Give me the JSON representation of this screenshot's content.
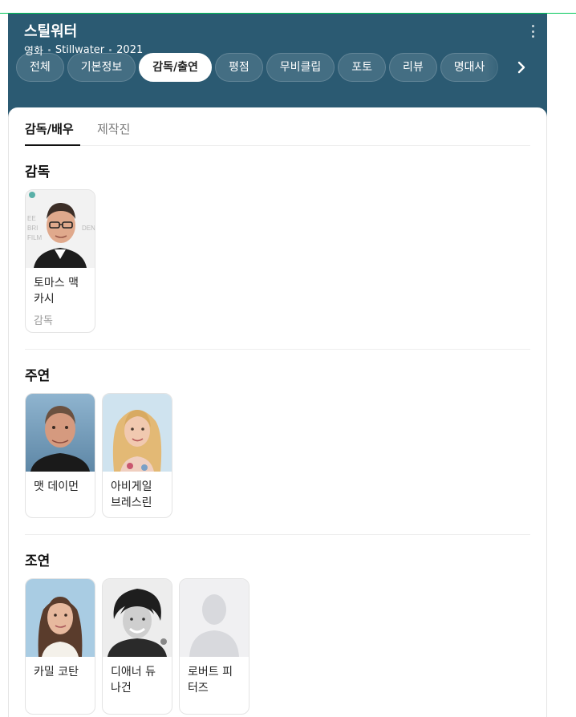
{
  "movie": {
    "title": "스틸워터",
    "type": "영화",
    "original_title": "Stillwater",
    "year": "2021"
  },
  "tabs": [
    {
      "label": "전체",
      "active": false
    },
    {
      "label": "기본정보",
      "active": false
    },
    {
      "label": "감독/출연",
      "active": true
    },
    {
      "label": "평점",
      "active": false
    },
    {
      "label": "무비클립",
      "active": false
    },
    {
      "label": "포토",
      "active": false
    },
    {
      "label": "리뷰",
      "active": false
    },
    {
      "label": "명대사",
      "active": false
    }
  ],
  "subtabs": [
    {
      "label": "감독/배우",
      "active": true
    },
    {
      "label": "제작진",
      "active": false
    }
  ],
  "sections": {
    "director": {
      "title": "감독",
      "people": [
        {
          "name": "토마스 맥카시",
          "role": "감독"
        }
      ]
    },
    "lead": {
      "title": "주연",
      "people": [
        {
          "name": "맷 데이먼"
        },
        {
          "name": "아비게일 브레스린"
        }
      ]
    },
    "supporting": {
      "title": "조연",
      "people": [
        {
          "name": "카밀 코탄"
        },
        {
          "name": "디애너 듀나건"
        },
        {
          "name": "로버트 피터즈"
        }
      ]
    }
  },
  "colors": {
    "header_bg": "#2b5a72",
    "accent": "#03c75a"
  }
}
